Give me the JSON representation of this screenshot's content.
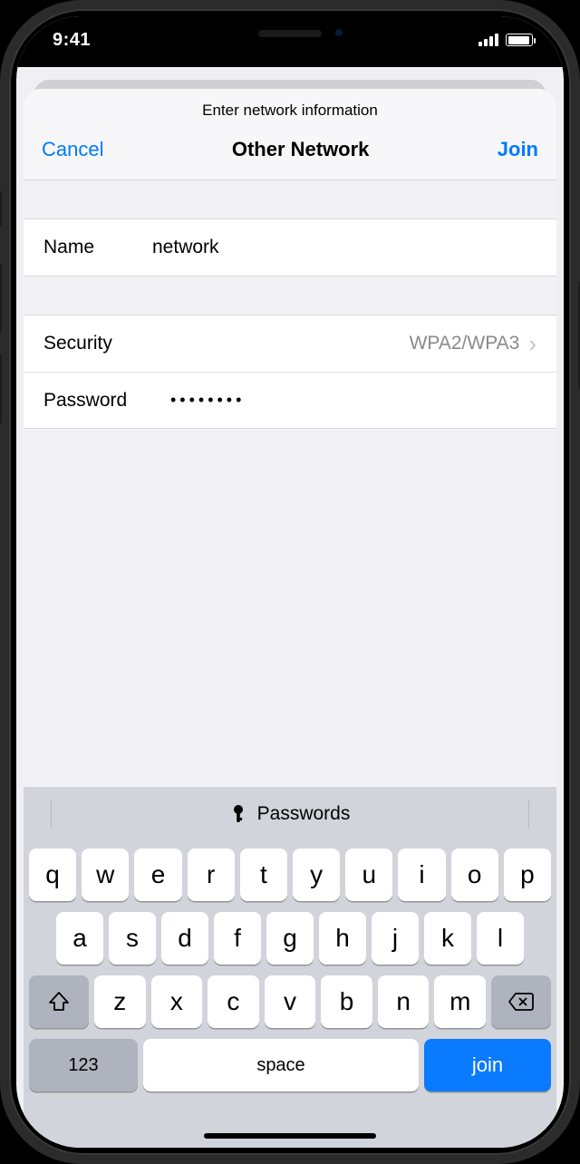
{
  "status": {
    "time": "9:41"
  },
  "sheet": {
    "subtitle": "Enter network information",
    "cancel": "Cancel",
    "title": "Other Network",
    "join": "Join"
  },
  "form": {
    "name_label": "Name",
    "name_value": "network",
    "security_label": "Security",
    "security_value": "WPA2/WPA3",
    "password_label": "Password",
    "password_value": "••••••••"
  },
  "keyboard": {
    "suggestion": "Passwords",
    "row1": [
      "q",
      "w",
      "e",
      "r",
      "t",
      "y",
      "u",
      "i",
      "o",
      "p"
    ],
    "row2": [
      "a",
      "s",
      "d",
      "f",
      "g",
      "h",
      "j",
      "k",
      "l"
    ],
    "row3": [
      "z",
      "x",
      "c",
      "v",
      "b",
      "n",
      "m"
    ],
    "numkey": "123",
    "space": "space",
    "join": "join"
  }
}
